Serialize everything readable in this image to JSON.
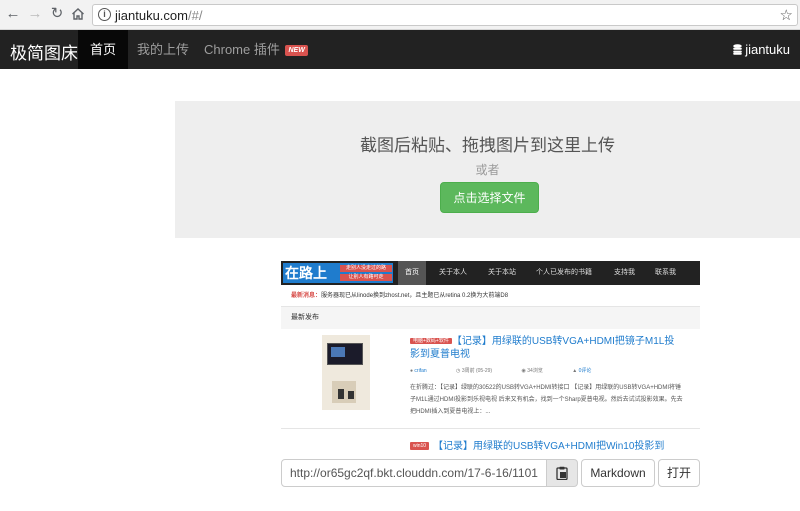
{
  "browser": {
    "url_host": "jiantuku.com",
    "url_path": "/#/"
  },
  "navbar": {
    "brand": "极简图床",
    "items": [
      {
        "label": "首页"
      },
      {
        "label": "我的上传"
      },
      {
        "label": "Chrome 插件"
      }
    ],
    "badge": "NEW",
    "user": "jiantuku"
  },
  "upload": {
    "title": "截图后粘贴、拖拽图片到这里上传",
    "or": "或者",
    "choose_button": "点击选择文件"
  },
  "preview": {
    "logo_main": "在路上",
    "logo_sub1": "走别人没走过的路",
    "logo_sub2": "让别人有路可走",
    "nav": [
      "首页",
      "关于本人",
      "关于本站",
      "个人已发布的书籍",
      "支持我",
      "联系我"
    ],
    "notice_label": "最新消息：",
    "notice_text": "服务器现已从linode换到zhost.net，且主题已从retina 0.2换为大前端D8",
    "section": "最新发布",
    "post1": {
      "category": "电脑+数码+软件",
      "title": "【记录】用绿联的USB转VGA+HDMI把镜子M1L投影到夏普电视",
      "author": "crifan",
      "date": "3周前 (05-29)",
      "views": "34浏览",
      "comments": "0评论",
      "excerpt": "在折腾过：【记录】绿联的30522的USB转VGA+HDMI转接口 【记录】用绿联的USB转VGA+HDMI将锤子M1L通过HDMI投影到乐视电视 后来又有机会，找到一个Sharp夏普电视。然后去试试投影效果。先去把HDMI插入到夏普电视上：..."
    },
    "post2": {
      "category": "win10",
      "title": "【记录】用绿联的USB转VGA+HDMI把Win10投影到"
    }
  },
  "actions": {
    "url_value": "http://or65gc2qf.bkt.clouddn.com/17-6-16/11012061.jpg",
    "markdown_button": "Markdown",
    "open_button": "打开"
  }
}
